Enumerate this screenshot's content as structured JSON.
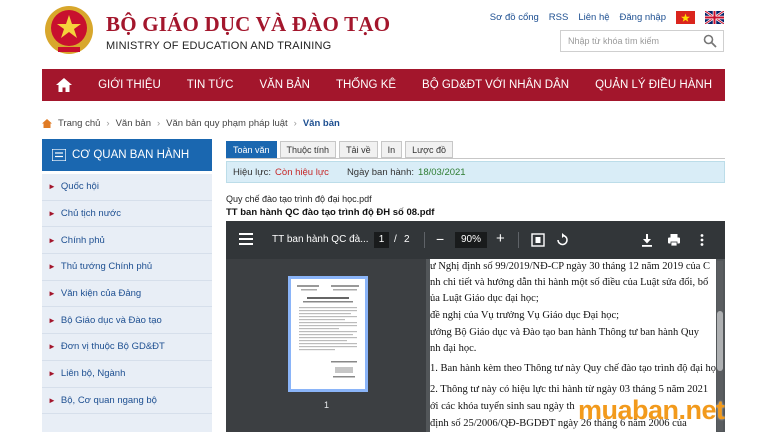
{
  "header": {
    "title_vn": "BỘ GIÁO DỤC VÀ ĐÀO TẠO",
    "title_en": "MINISTRY OF EDUCATION AND TRAINING",
    "links": [
      "Sơ đồ cổng",
      "RSS",
      "Liên hệ",
      "Đăng nhập"
    ],
    "search_placeholder": "Nhập từ khóa tìm kiếm",
    "brand_color": "#a3162c"
  },
  "nav": {
    "items": [
      "GIỚI THIỆU",
      "TIN TỨC",
      "VĂN BẢN",
      "THỐNG KÊ",
      "BỘ GD&ĐT VỚI NHÂN DÂN",
      "QUẢN LÝ ĐIỀU HÀNH"
    ]
  },
  "breadcrumb": [
    "Trang chủ",
    "Văn bản",
    "Văn bản quy phạm pháp luật",
    "Văn bản"
  ],
  "sidebar": {
    "heading": "CƠ QUAN BAN HÀNH",
    "items": [
      "Quốc hội",
      "Chủ tịch nước",
      "Chính phủ",
      "Thủ tướng Chính phủ",
      "Văn kiện của Đảng",
      "Bộ Giáo dục và Đào tạo",
      "Đơn vị thuộc Bộ GD&ĐT",
      "Liên bộ, Ngành",
      "Bộ, Cơ quan ngang bộ"
    ]
  },
  "tabs": [
    "Toàn văn",
    "Thuộc tính",
    "Tải về",
    "In",
    "Lược đồ"
  ],
  "status": {
    "validity_label": "Hiệu lực:",
    "validity_value": "Còn hiệu lực",
    "issued_label": "Ngày ban hành:",
    "issued_value": "18/03/2021"
  },
  "files": {
    "file1": "Quy chế đào tạo trình độ đại học.pdf",
    "file2": "TT ban hành QC đào tạo trình độ ĐH số 08.pdf"
  },
  "viewer": {
    "title": "TT ban hành QC đà...",
    "page": "1",
    "total": "2",
    "zoom": "90%",
    "thumb_label": "1",
    "doc_lines": [
      "ư Nghị định số 99/2019/NĐ-CP ngày 30 tháng 12 năm 2019 của C",
      "nh chi tiết và hướng dẫn thi hành một số điều của Luật sửa đổi, bổ",
      "ủa Luật Giáo dục đại học;",
      "đề nghị của Vụ trưởng Vụ Giáo dục Đại học;",
      "ưởng Bộ Giáo dục và Đào tạo ban hành Thông tư ban hành Quy",
      "nh đại học.",
      "1. Ban hành kèm theo Thông tư này Quy chế đào tạo trình độ đại học.",
      "2. Thông tư này có hiệu lực thi hành từ ngày 03 tháng 5 năm 2021",
      "ới các khóa tuyển sinh sau ngày th",
      " định số 25/2006/QĐ-BGDĐT ngày 26 tháng 6 năm 2006 của"
    ]
  },
  "watermark": "muaban.net"
}
